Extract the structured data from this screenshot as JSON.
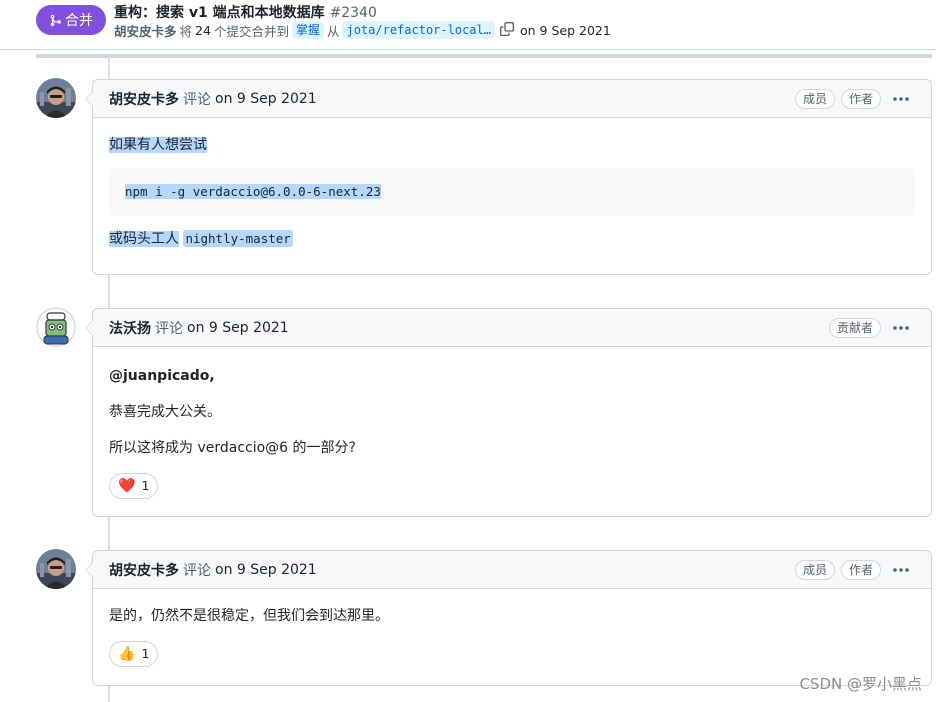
{
  "header": {
    "state_label": "合并",
    "title": "重构：搜索 v1 端点和本地数据库",
    "number": "#2340",
    "author": "胡安皮卡多",
    "merge_prefix": "将",
    "commit_count": "24",
    "merge_text": "个提交合并到",
    "base_branch": "掌握",
    "from_text": "从",
    "head_branch": "jota/refactor-local…",
    "date": "on 9 Sep 2021"
  },
  "comments": [
    {
      "author": "胡安皮卡多",
      "action": "评论",
      "date": "on 9 Sep 2021",
      "labels": [
        "成员",
        "作者"
      ],
      "line1": "如果有人想尝试",
      "code": "npm i -g verdaccio@6.0.0-6-next.23",
      "line2_prefix": "或码头工人",
      "line2_code": "nightly-master"
    },
    {
      "author": "法沃扬",
      "action": "评论",
      "date": "on 9 Sep 2021",
      "labels": [
        "贡献者"
      ],
      "mention": "@juanpicado,",
      "line1": "恭喜完成大公关。",
      "line2_prefix": "所以这将成为",
      "line2_strong": "verdaccio@6",
      "line2_suffix": "的一部分?",
      "reaction_emoji": "❤️",
      "reaction_count": "1"
    },
    {
      "author": "胡安皮卡多",
      "action": "评论",
      "date": "on 9 Sep 2021",
      "labels": [
        "成员",
        "作者"
      ],
      "line1": "是的，仍然不是很稳定，但我们会到达那里。",
      "reaction_emoji": "👍",
      "reaction_count": "1"
    }
  ],
  "watermark": "CSDN @罗小黑点"
}
